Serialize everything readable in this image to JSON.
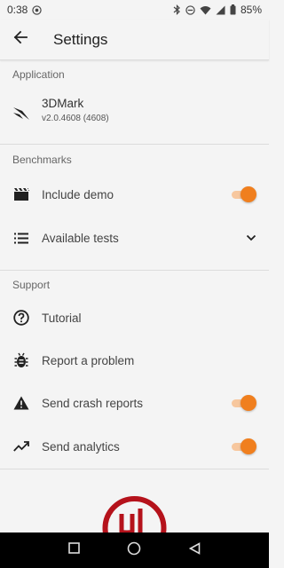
{
  "status": {
    "time": "0:38",
    "battery": "85%"
  },
  "header": {
    "title": "Settings"
  },
  "sections": {
    "application": "Application",
    "benchmarks": "Benchmarks",
    "support": "Support"
  },
  "application": {
    "name": "3DMark",
    "version": "v2.0.4608 (4608)"
  },
  "benchmarks": {
    "include_demo": "Include demo",
    "include_demo_on": true,
    "available_tests": "Available tests"
  },
  "support": {
    "tutorial": "Tutorial",
    "report_problem": "Report a problem",
    "send_crash_reports": "Send crash reports",
    "send_crash_reports_on": true,
    "send_analytics": "Send analytics",
    "send_analytics_on": true
  },
  "colors": {
    "accent": "#f07f1e",
    "accent_track": "#f7c79e",
    "logo_red": "#b5121b"
  }
}
